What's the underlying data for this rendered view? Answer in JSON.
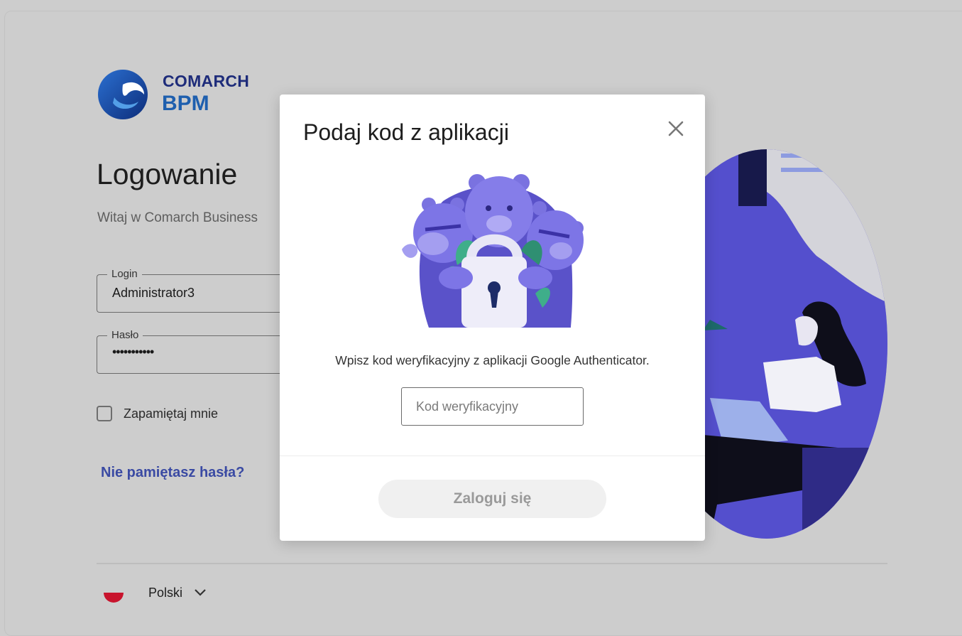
{
  "brand": {
    "line1": "COMARCH",
    "line2": "BPM"
  },
  "login": {
    "title": "Logowanie",
    "subtitle": "Witaj w Comarch Business",
    "login_label": "Login",
    "login_value": "Administrator3",
    "password_label": "Hasło",
    "password_value": "•••••••••••",
    "remember_label": "Zapamiętaj mnie",
    "forgot_link": "Nie pamiętasz hasła?"
  },
  "language": {
    "selected": "Polski"
  },
  "modal": {
    "title": "Podaj kod z aplikacji",
    "description": "Wpisz kod weryfikacyjny z aplikacji Google Authenticator.",
    "code_placeholder": "Kod weryfikacyjny",
    "submit_label": "Zaloguj się"
  },
  "icons": {
    "close": "close-icon",
    "chevron": "chevron-down-icon",
    "flag": "poland-flag-icon",
    "logo": "comarch-logo"
  },
  "colors": {
    "brand_dark": "#1e2c7a",
    "brand_blue": "#1e5fae",
    "link": "#3a4aa3",
    "illustration_purple": "#5e58d6"
  }
}
